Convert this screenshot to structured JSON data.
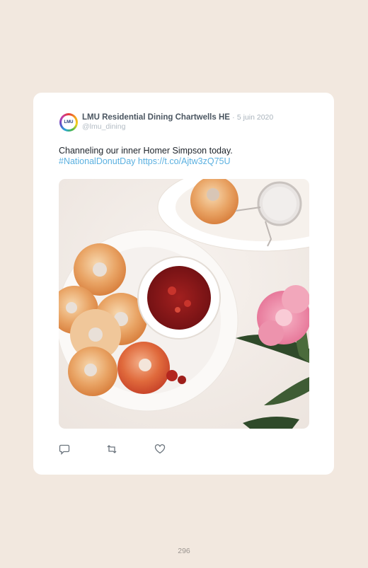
{
  "tweet": {
    "avatar_text": "LMU",
    "author": "LMU Residential Dining Chartwells HE",
    "separator": "·",
    "date": "5 juin 2020",
    "handle": "@lmu_dining",
    "text": "Channeling our inner Homer Simpson today.",
    "hashtag": "#NationalDonutDay",
    "link": "https://t.co/Ajtw3zQ75U",
    "image_icons": [
      "comment-icon",
      "retweet-icon",
      "heart-icon"
    ]
  },
  "page": {
    "number": "296"
  },
  "colors": {
    "background": "#f2e8df",
    "card": "#ffffff",
    "link": "#5ab0e0",
    "author": "#4a5560"
  }
}
